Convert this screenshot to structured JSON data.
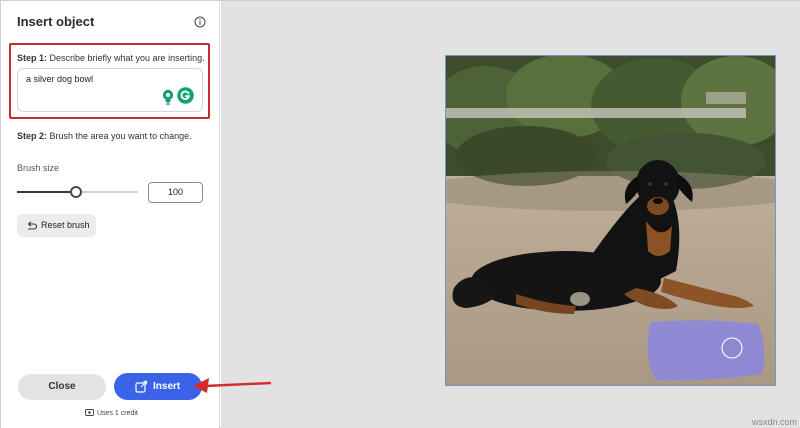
{
  "panel": {
    "title": "Insert object",
    "step1": {
      "prefix": "Step 1:",
      "text": " Describe briefly what you are inserting."
    },
    "prompt_value": "a silver dog bowl",
    "step2": {
      "prefix": "Step 2:",
      "text": " Brush the area you want to change."
    },
    "brush_size_label": "Brush size",
    "brush_size_value": "100",
    "brush_slider_fraction": 0.49,
    "reset_label": "Reset brush",
    "close_label": "Close",
    "insert_label": "Insert",
    "credit_note": "Uses 1 credit"
  },
  "icons": [
    "info-icon",
    "lightbulb-icon",
    "grammarly-icon",
    "reset-icon",
    "insert-icon",
    "credit-icon"
  ],
  "colors": {
    "accent": "#3b63e8",
    "highlight_box": "#c62b2b",
    "arrow": "#d42a2a",
    "brush_mask": "#8b85e0"
  },
  "watermark": "wsxdn.com"
}
